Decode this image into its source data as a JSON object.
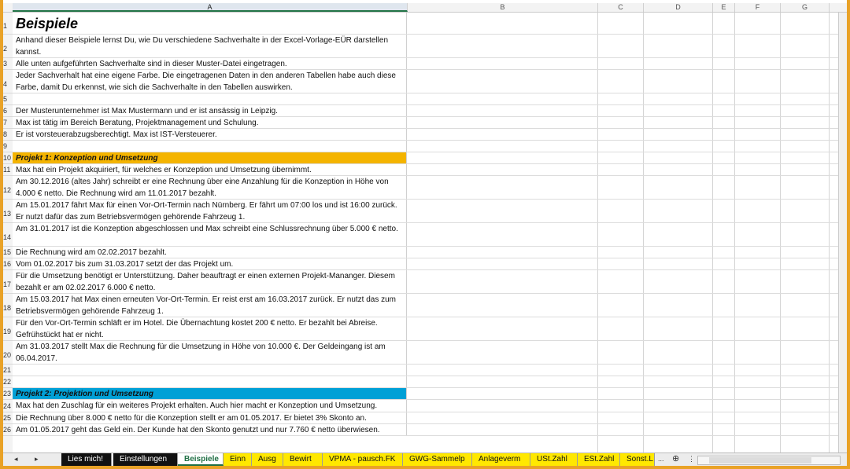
{
  "columns": [
    "A",
    "B",
    "C",
    "D",
    "E",
    "F",
    "G"
  ],
  "rows": [
    {
      "n": "1",
      "text": "Beispiele",
      "style": "title"
    },
    {
      "n": "2",
      "text": "Anhand dieser Beispiele lernst Du, wie Du verschiedene Sachverhalte in der Excel-Vorlage-EÜR darstellen kannst."
    },
    {
      "n": "3",
      "text": "Alle unten aufgeführten Sachverhalte sind in dieser Muster-Datei eingetragen."
    },
    {
      "n": "4",
      "text": "Jeder Sachverhalt hat eine eigene Farbe. Die eingetragenen Daten in den anderen Tabellen habe auch diese Farbe, damit Du erkennst, wie sich die Sachverhalte in den Tabellen auswirken."
    },
    {
      "n": "5",
      "text": ""
    },
    {
      "n": "6",
      "text": "Der Musterunternehmer ist Max Mustermann und er ist ansässig in Leipzig."
    },
    {
      "n": "7",
      "text": "Max ist tätig im Bereich Beratung, Projektmanagement und Schulung."
    },
    {
      "n": "8",
      "text": "Er ist vorsteuerabzugsberechtigt. Max ist IST-Versteuerer."
    },
    {
      "n": "9",
      "text": ""
    },
    {
      "n": "10",
      "text": "Projekt 1: Konzeption und Umsetzung",
      "style": "head1"
    },
    {
      "n": "11",
      "text": "Max hat ein Projekt akquiriert, für welches er Konzeption und Umsetzung übernimmt."
    },
    {
      "n": "12",
      "text": "Am 30.12.2016 (altes Jahr) schreibt er eine Rechnung über eine Anzahlung für die Konzeption in Höhe von 4.000 € netto. Die Rechnung wird am 11.01.2017 bezahlt."
    },
    {
      "n": "13",
      "text": "Am 15.01.2017 fährt Max für einen Vor-Ort-Termin nach Nürnberg. Er fährt um 07:00 los und ist 16:00 zurück. Er nutzt dafür das zum Betriebsvermögen gehörende Fahrzeug 1."
    },
    {
      "n": "14",
      "text": "Am 31.01.2017 ist die Konzeption abgeschlossen und Max schreibt eine Schlussrechnung über 5.000 € netto."
    },
    {
      "n": "15",
      "text": "Die Rechnung wird am 02.02.2017 bezahlt."
    },
    {
      "n": "16",
      "text": "Vom 01.02.2017 bis zum 31.03.2017 setzt der das Projekt um."
    },
    {
      "n": "17",
      "text": "Für die Umsetzung benötigt er Unterstützung. Daher beauftragt er einen externen Projekt-Mananger. Diesem bezahlt er am 02.02.2017 6.000 € netto."
    },
    {
      "n": "18",
      "text": "Am 15.03.2017 hat Max einen erneuten Vor-Ort-Termin. Er reist erst am 16.03.2017 zurück. Er nutzt das zum Betriebsvermögen gehörende Fahrzeug 1."
    },
    {
      "n": "19",
      "text": "Für den Vor-Ort-Termin schläft er im Hotel. Die Übernachtung kostet 200 € netto. Er bezahlt bei Abreise. Gefrühstückt hat er nicht."
    },
    {
      "n": "20",
      "text": "Am 31.03.2017 stellt Max die Rechnung für die Umsetzung in Höhe von 10.000 €. Der Geldeingang ist am 06.04.2017."
    },
    {
      "n": "21",
      "text": ""
    },
    {
      "n": "22",
      "text": ""
    },
    {
      "n": "23",
      "text": "Projekt 2: Projektion und Umsetzung",
      "style": "head2"
    },
    {
      "n": "24",
      "text": "Max hat den Zuschlag für ein weiteres Projekt erhalten. Auch hier macht er Konzeption und Umsetzung."
    },
    {
      "n": "25",
      "text": "Die Rechnung über 8.000 € netto für die Konzeption stellt er am  01.05.2017. Er bietet 3% Skonto an."
    },
    {
      "n": "26",
      "text": "Am 01.05.2017 geht das Geld ein. Der Kunde hat den Skonto genutzt und nur 7.760 € netto überwiesen."
    }
  ],
  "tabs": [
    {
      "label": "Lies mich!",
      "style": "dark"
    },
    {
      "label": "Einstellungen",
      "style": "dark"
    },
    {
      "label": "Beispiele",
      "style": "active"
    },
    {
      "label": "Einn",
      "style": "yellow"
    },
    {
      "label": "Ausg",
      "style": "yellow"
    },
    {
      "label": "Bewirt",
      "style": "yellow"
    },
    {
      "label": "VPMA - pausch.FK",
      "style": "yellow"
    },
    {
      "label": "GWG-Sammelp",
      "style": "yellow"
    },
    {
      "label": "Anlageverm",
      "style": "yellow"
    },
    {
      "label": "USt.Zahl",
      "style": "yellow"
    },
    {
      "label": "ESt.Zahl",
      "style": "yellow"
    },
    {
      "label": "Sonst.L",
      "style": "yellow"
    }
  ],
  "nav": {
    "prev": "◂",
    "next": "▸",
    "more": "...",
    "add": "⊕"
  },
  "colors": {
    "accent": "#217346",
    "project1": "#f4b400",
    "project2": "#00a0d6",
    "tab_yellow": "#ffe800",
    "frame": "#e9a227"
  }
}
